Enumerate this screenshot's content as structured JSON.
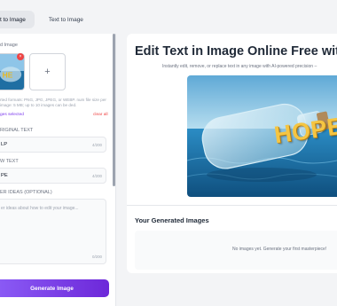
{
  "tabs": [
    {
      "label": "t to Image",
      "active": true
    },
    {
      "label": "Text to Image",
      "active": false
    }
  ],
  "upload": {
    "section_label": "d Image",
    "remove_glyph": "×",
    "add_glyph": "+",
    "hint": "rted formats: PNG, JPG, JPEG, or WEBP. num file size per image: 5 MB; up to 10 images can be ded.",
    "selected_text": "ges selected",
    "clear_label": "clear all",
    "thumb_word": "HELP"
  },
  "original_text": {
    "label": "RIGINAL TEXT",
    "value": "LP",
    "count": "4/200"
  },
  "new_text": {
    "label": "W TEXT",
    "value": "PE",
    "count": "4/200"
  },
  "other_ideas": {
    "label": "ER IDEAS (OPTIONAL)",
    "placeholder": "er ideas about how to edit your image...",
    "count": "0/200"
  },
  "generate_button": "Generate Image",
  "hero": {
    "title": "Edit Text in Image Online Free wit",
    "subtitle": "Instantly edit, remove, or replace text in any image with AI-powered precision –",
    "image_word": "HOPE"
  },
  "generated": {
    "title": "Your Generated Images",
    "empty": "No images yet. Generate your first masterpiece!"
  },
  "colors": {
    "accent": "#7c3aed",
    "danger": "#ef4444",
    "background": "#f3f4f6"
  }
}
